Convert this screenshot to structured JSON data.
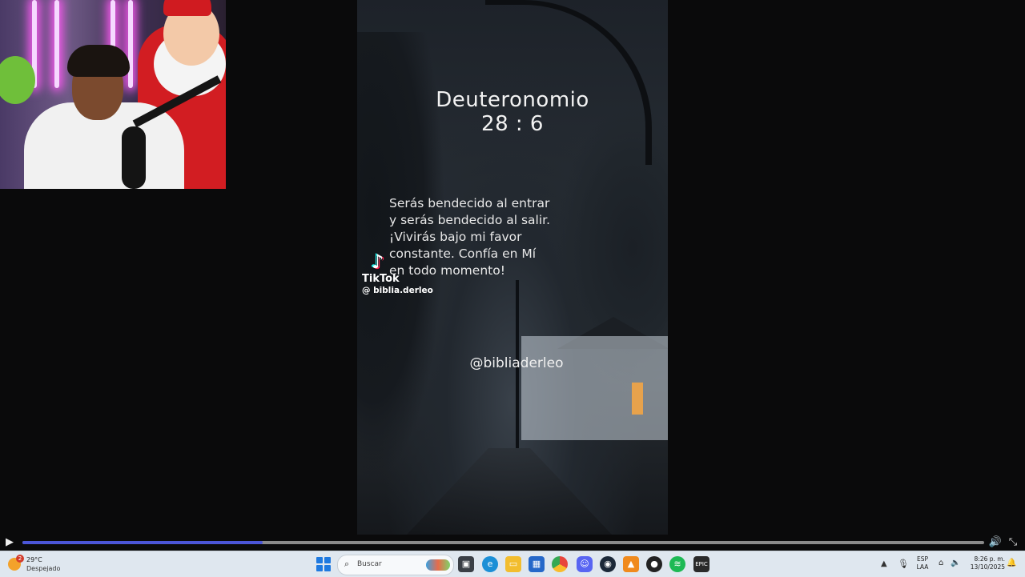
{
  "video": {
    "verse_title_line1": "Deuteronomio",
    "verse_title_line2": "28 : 6",
    "verse_lines": [
      "Serás bendecido al entrar",
      "y serás bendecido al salir.",
      "¡Vivirás bajo mi favor",
      "constante. Confía en Mí",
      "en todo momento!"
    ],
    "watermark_brand": "TikTok",
    "watermark_handle": "@ biblia.derleo",
    "overlay_handle": "@bibliaderleo"
  },
  "player": {
    "progress_fraction": 0.25,
    "accent_color": "#4b55d8"
  },
  "taskbar": {
    "weather": {
      "badge": "2",
      "temperature": "29°C",
      "condition": "Despejado"
    },
    "search_placeholder": "Buscar",
    "pinned_apps": [
      "task-view",
      "edge",
      "file-explorer",
      "microsoft-store",
      "chrome",
      "discord",
      "steam",
      "vlc",
      "obs",
      "spotify",
      "epic-games"
    ],
    "language_line1": "ESP",
    "language_line2": "LAA",
    "time": "8:26 p. m.",
    "date": "13/10/2025"
  }
}
